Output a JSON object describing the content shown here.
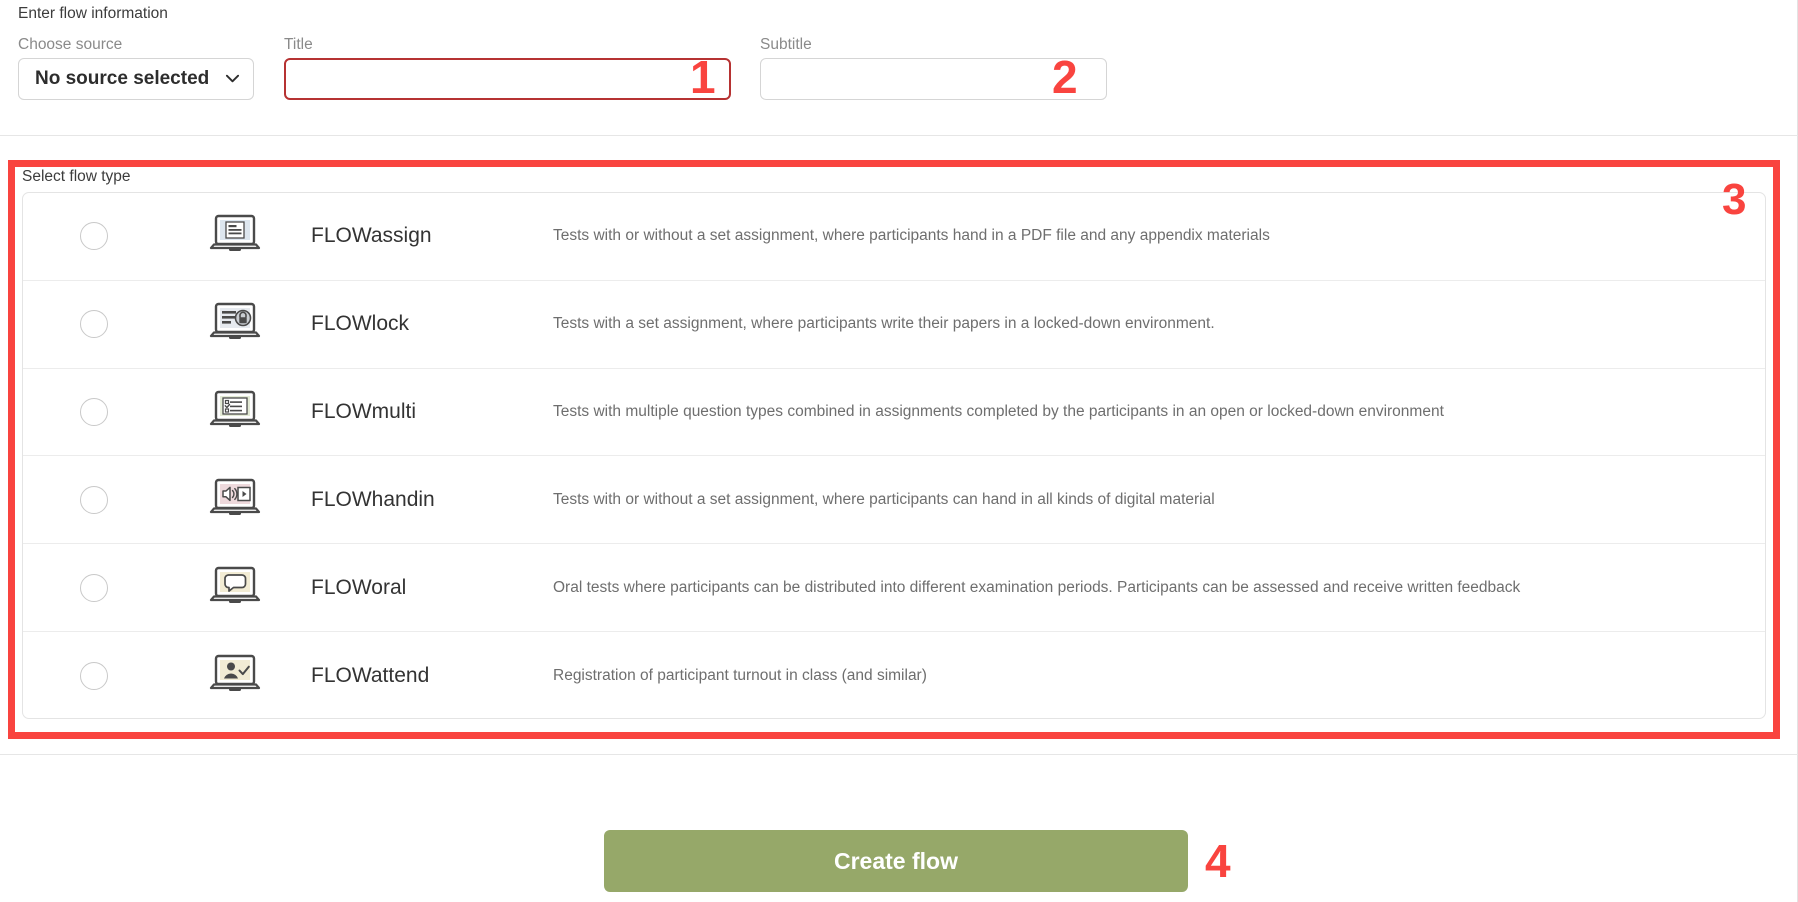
{
  "info": {
    "caption": "Enter flow information",
    "source": {
      "label": "Choose source",
      "value": "No source selected",
      "icon": "chevron-down-icon"
    },
    "title": {
      "label": "Title",
      "value": "",
      "placeholder": ""
    },
    "subtitle": {
      "label": "Subtitle",
      "value": "",
      "placeholder": ""
    }
  },
  "flow_type": {
    "caption": "Select flow type",
    "rows": [
      {
        "name": "FLOWassign",
        "description": "Tests with or without a set assignment, where participants hand in a PDF file and any appendix materials",
        "icon": "laptop-document-icon",
        "selected": false
      },
      {
        "name": "FLOWlock",
        "description": "Tests with a set assignment, where participants write their papers in a locked-down environment.",
        "icon": "laptop-lock-icon",
        "selected": false
      },
      {
        "name": "FLOWmulti",
        "description": "Tests with multiple question types combined in assignments completed by the participants in an open or locked-down environment",
        "icon": "laptop-checklist-icon",
        "selected": false
      },
      {
        "name": "FLOWhandin",
        "description": "Tests with or without a set assignment, where participants can hand in all kinds of digital material",
        "icon": "laptop-media-icon",
        "selected": false
      },
      {
        "name": "FLOWoral",
        "description": "Oral tests where participants can be distributed into different examination periods. Participants can be assessed and receive written feedback",
        "icon": "laptop-speech-bubble-icon",
        "selected": false
      },
      {
        "name": "FLOWattend",
        "description": "Registration of participant turnout in class (and similar)",
        "icon": "laptop-person-check-icon",
        "selected": false
      }
    ]
  },
  "submit": {
    "create_label": "Create flow"
  },
  "annotations": {
    "one": "1",
    "two": "2",
    "three": "3",
    "four": "4"
  },
  "colors": {
    "annotation_red": "#f9443f",
    "error_border": "#b63232",
    "create_button": "#96a869",
    "label_gray": "#8a8a8a",
    "description_gray": "#6e6e6e"
  }
}
